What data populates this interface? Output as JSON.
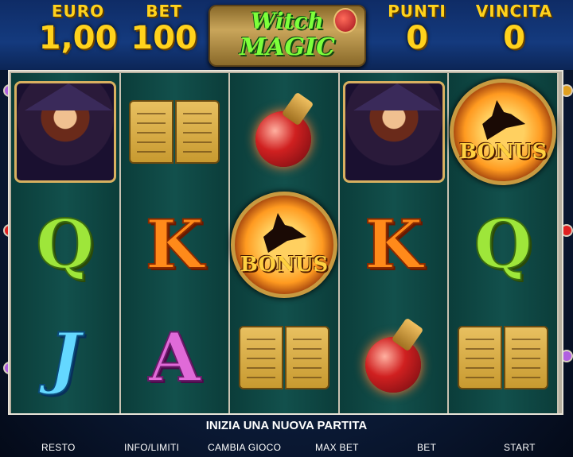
{
  "header": {
    "euro_label": "EURO",
    "euro_value": "1,00",
    "bet_label": "BET",
    "bet_value": "100",
    "punti_label": "PUNTI",
    "punti_value": "0",
    "vincita_label": "VINCITA",
    "vincita_value": "0",
    "logo_line1": "Witch",
    "logo_line2": "MAGIC"
  },
  "reels": [
    [
      "witch",
      "Q",
      "J"
    ],
    [
      "book",
      "K",
      "A"
    ],
    [
      "potion",
      "bonus",
      "book"
    ],
    [
      "witch",
      "K",
      "potion"
    ],
    [
      "bonus",
      "Q",
      "book"
    ]
  ],
  "bonus_text": "BONUS",
  "message": "INIZIA UNA NUOVA PARTITA",
  "buttons": {
    "resto": "RESTO",
    "info": "INFO/LIMITI",
    "cambia": "CAMBIA GIOCO",
    "maxbet": "MAX BET",
    "bet": "BET",
    "start": "START"
  },
  "colors": {
    "gold": "#ffd21c",
    "logo_green": "#7dff3a",
    "reel_teal": "#12504c"
  }
}
